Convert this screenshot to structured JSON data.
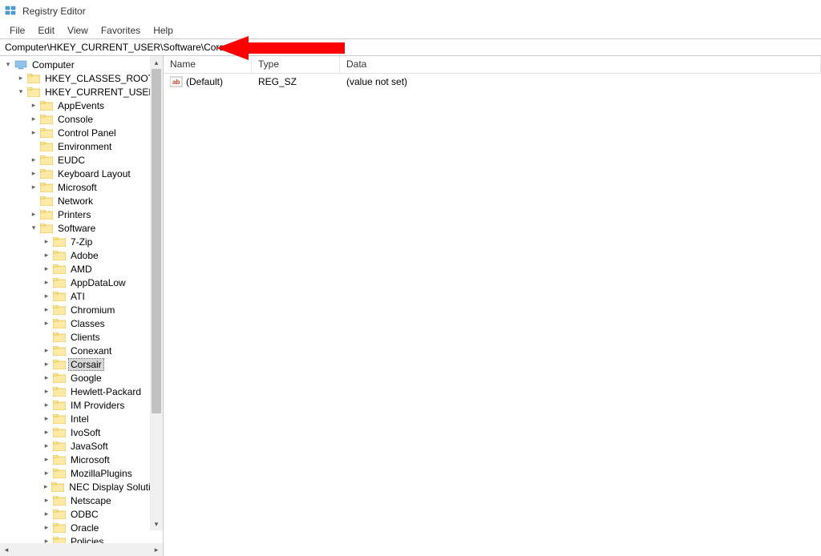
{
  "window": {
    "title": "Registry Editor"
  },
  "menu": {
    "file": "File",
    "edit": "Edit",
    "view": "View",
    "favorites": "Favorites",
    "help": "Help"
  },
  "address": "Computer\\HKEY_CURRENT_USER\\Software\\Corsair",
  "tree": {
    "root": "Computer",
    "hkcr": "HKEY_CLASSES_ROOT",
    "hkcu": "HKEY_CURRENT_USER",
    "appevents": "AppEvents",
    "console": "Console",
    "controlpanel": "Control Panel",
    "environment": "Environment",
    "eudc": "EUDC",
    "keyboard": "Keyboard Layout",
    "microsoft_top": "Microsoft",
    "network": "Network",
    "printers": "Printers",
    "software": "Software",
    "szip": "7-Zip",
    "adobe": "Adobe",
    "amd": "AMD",
    "appdatalow": "AppDataLow",
    "ati": "ATI",
    "chromium": "Chromium",
    "classes": "Classes",
    "clients": "Clients",
    "conexant": "Conexant",
    "corsair": "Corsair",
    "google": "Google",
    "hp": "Hewlett-Packard",
    "improviders": "IM Providers",
    "intel": "Intel",
    "ivosoft": "IvoSoft",
    "javasoft": "JavaSoft",
    "microsoft": "Microsoft",
    "mozillaplugins": "MozillaPlugins",
    "nec": "NEC Display Solution",
    "netscape": "Netscape",
    "odbc": "ODBC",
    "oracle": "Oracle",
    "policies": "Policies"
  },
  "list": {
    "headers": {
      "name": "Name",
      "type": "Type",
      "data": "Data"
    },
    "rows": [
      {
        "name": "(Default)",
        "type": "REG_SZ",
        "data": "(value not set)"
      }
    ]
  }
}
